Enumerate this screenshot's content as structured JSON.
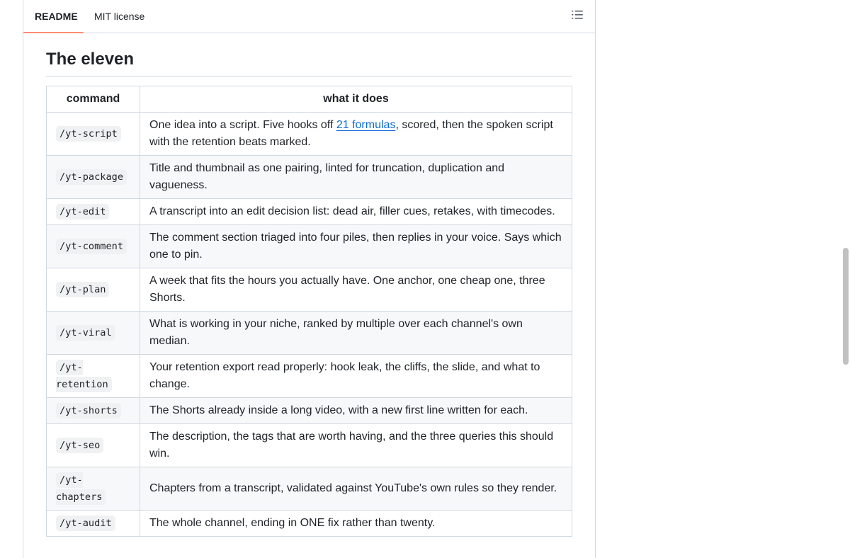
{
  "tabs": [
    {
      "label": "README",
      "active": true
    },
    {
      "label": "MIT license",
      "active": false
    }
  ],
  "toc_icon": "list-unordered-icon",
  "heading": "The eleven",
  "table": {
    "headers": [
      "command",
      "what it does"
    ],
    "rows": [
      {
        "command": "/yt-script",
        "desc_before": "One idea into a script. Five hooks off ",
        "desc_link": "21 formulas",
        "desc_after": ", scored, then the spoken script with the retention beats marked."
      },
      {
        "command": "/yt-package",
        "desc": "Title and thumbnail as one pairing, linted for truncation, duplication and vagueness."
      },
      {
        "command": "/yt-edit",
        "desc": "A transcript into an edit decision list: dead air, filler cues, retakes, with timecodes."
      },
      {
        "command": "/yt-comment",
        "desc": "The comment section triaged into four piles, then replies in your voice. Says which one to pin."
      },
      {
        "command": "/yt-plan",
        "desc": "A week that fits the hours you actually have. One anchor, one cheap one, three Shorts."
      },
      {
        "command": "/yt-viral",
        "desc": "What is working in your niche, ranked by multiple over each channel's own median."
      },
      {
        "command": "/yt-retention",
        "desc": "Your retention export read properly: hook leak, the cliffs, the slide, and what to change."
      },
      {
        "command": "/yt-shorts",
        "desc": "The Shorts already inside a long video, with a new first line written for each."
      },
      {
        "command": "/yt-seo",
        "desc": "The description, the tags that are worth having, and the three queries this should win."
      },
      {
        "command": "/yt-chapters",
        "desc": "Chapters from a transcript, validated against YouTube's own rules so they render."
      },
      {
        "command": "/yt-audit",
        "desc": "The whole channel, ending in ONE fix rather than twenty."
      }
    ]
  },
  "colors": {
    "tab_underline": "#fd8c73",
    "link": "#0969da",
    "border": "#d1d9e0",
    "stripe": "#f6f8fa",
    "code_bg": "#eff1f3"
  }
}
